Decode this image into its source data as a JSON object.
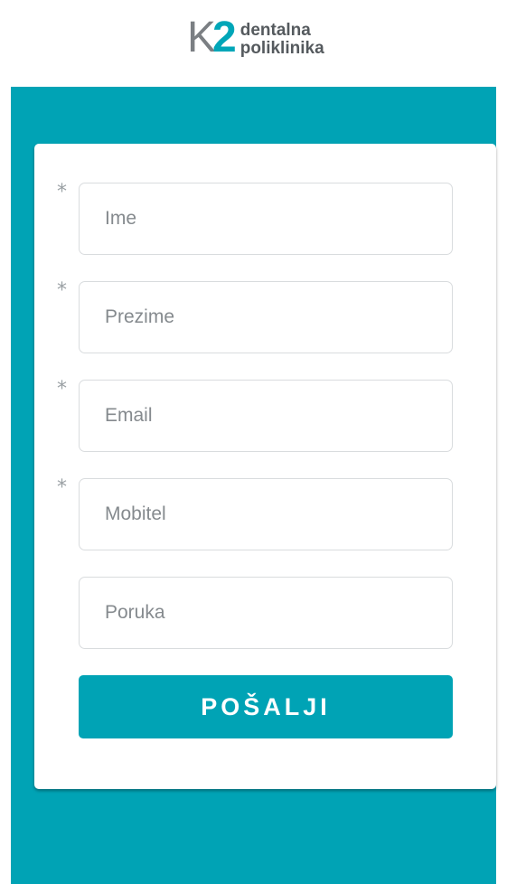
{
  "logo": {
    "mark_k": "K",
    "mark_2": "2",
    "line1": "dentalna",
    "line2": "poliklinika"
  },
  "form": {
    "fields": [
      {
        "placeholder": "Ime",
        "required": true,
        "required_mark": "*"
      },
      {
        "placeholder": "Prezime",
        "required": true,
        "required_mark": "*"
      },
      {
        "placeholder": "Email",
        "required": true,
        "required_mark": "*"
      },
      {
        "placeholder": "Mobitel",
        "required": true,
        "required_mark": "*"
      },
      {
        "placeholder": "Poruka",
        "required": false,
        "required_mark": ""
      }
    ],
    "submit_label": "POŠALJI"
  },
  "colors": {
    "brand_teal": "#00a3b5",
    "logo_gray": "#7b7f83"
  }
}
